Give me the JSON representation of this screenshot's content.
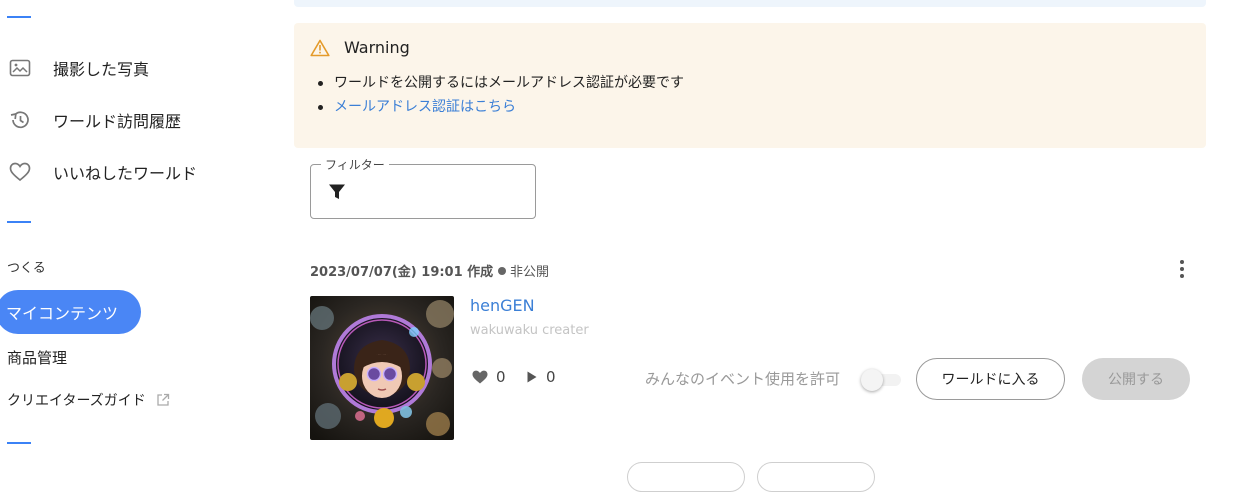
{
  "sidebar": {
    "items": [
      {
        "label": "撮影した写真",
        "icon": "photo-album-icon"
      },
      {
        "label": "ワールド訪問履歴",
        "icon": "history-icon"
      },
      {
        "label": "いいねしたワールド",
        "icon": "heart-outline-icon"
      }
    ],
    "section_create": "つくる",
    "my_contents": "マイコンテンツ",
    "product_management": "商品管理",
    "creators_guide": "クリエイターズガイド",
    "accent_color": "#4a86f5"
  },
  "warning": {
    "title": "Warning",
    "message": "ワールドを公開するにはメールアドレス認証が必要です",
    "link": "メールアドレス認証はこちら",
    "icon": "warning-triangle-icon",
    "color": "#fcf5ea"
  },
  "filter": {
    "label": "フィルター",
    "icon": "filter-icon"
  },
  "world": {
    "created": "2023/07/07(金) 19:01 作成",
    "status": "非公開",
    "name": "henGEN",
    "creator": "wakuwaku creater",
    "likes": "0",
    "plays": "0",
    "event_permission_label": "みんなのイベント使用を許可",
    "event_permission_enabled": false,
    "enter_button": "ワールドに入る",
    "publish_button": "公開する",
    "link_color": "#3b7fd6"
  }
}
